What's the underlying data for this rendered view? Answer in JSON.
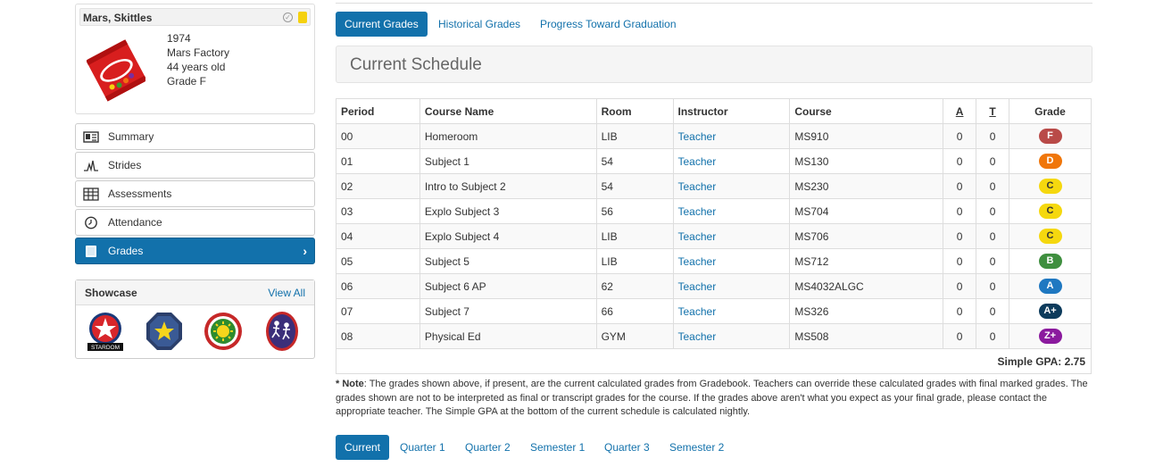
{
  "profile": {
    "name": "Mars, Skittles",
    "lines": [
      "1974",
      "Mars Factory",
      "44 years old",
      "Grade F"
    ],
    "check_icon": "check-circle-icon",
    "note_icon": "sticky-note-icon"
  },
  "nav": {
    "items": [
      {
        "label": "Summary",
        "icon": "id-card-icon"
      },
      {
        "label": "Strides",
        "icon": "pulse-icon"
      },
      {
        "label": "Assessments",
        "icon": "spreadsheet-icon"
      },
      {
        "label": "Attendance",
        "icon": "clock-icon"
      },
      {
        "label": "Grades",
        "icon": "book-icon"
      }
    ],
    "active": "Grades"
  },
  "showcase": {
    "title": "Showcase",
    "view_all": "View All",
    "badge_text": "STARDOM"
  },
  "tabs": [
    "Current Grades",
    "Historical Grades",
    "Progress Toward Graduation"
  ],
  "schedule": {
    "title": "Current Schedule",
    "headers": [
      "Period",
      "Course Name",
      "Room",
      "Instructor",
      "Course",
      "A",
      "T",
      "Grade"
    ],
    "rows": [
      {
        "period": "00",
        "course_name": "Homeroom",
        "room": "LIB",
        "instructor": "Teacher",
        "course": "MS910",
        "a": "0",
        "t": "0",
        "grade": "F",
        "color": "#b94a48"
      },
      {
        "period": "01",
        "course_name": "Subject 1",
        "room": "54",
        "instructor": "Teacher",
        "course": "MS130",
        "a": "0",
        "t": "0",
        "grade": "D",
        "color": "#f0760a"
      },
      {
        "period": "02",
        "course_name": "Intro to Subject 2",
        "room": "54",
        "instructor": "Teacher",
        "course": "MS230",
        "a": "0",
        "t": "0",
        "grade": "C",
        "color": "#f5d80e"
      },
      {
        "period": "03",
        "course_name": "Explo Subject 3",
        "room": "56",
        "instructor": "Teacher",
        "course": "MS704",
        "a": "0",
        "t": "0",
        "grade": "C",
        "color": "#f5d80e"
      },
      {
        "period": "04",
        "course_name": "Explo Subject 4",
        "room": "LIB",
        "instructor": "Teacher",
        "course": "MS706",
        "a": "0",
        "t": "0",
        "grade": "C",
        "color": "#f5d80e"
      },
      {
        "period": "05",
        "course_name": "Subject 5",
        "room": "LIB",
        "instructor": "Teacher",
        "course": "MS712",
        "a": "0",
        "t": "0",
        "grade": "B",
        "color": "#3f8f3f"
      },
      {
        "period": "06",
        "course_name": "Subject 6 AP",
        "room": "62",
        "instructor": "Teacher",
        "course": "MS4032ALGC",
        "a": "0",
        "t": "0",
        "grade": "A",
        "color": "#1f78c1"
      },
      {
        "period": "07",
        "course_name": "Subject 7",
        "room": "66",
        "instructor": "Teacher",
        "course": "MS326",
        "a": "0",
        "t": "0",
        "grade": "A+",
        "color": "#0d3b5c"
      },
      {
        "period": "08",
        "course_name": "Physical Ed",
        "room": "GYM",
        "instructor": "Teacher",
        "course": "MS508",
        "a": "0",
        "t": "0",
        "grade": "Z+",
        "color": "#8b1a9e"
      }
    ],
    "gpa": "Simple GPA: 2.75"
  },
  "note": {
    "label": "* Note",
    "text": ": The grades shown above, if present, are the current calculated grades from Gradebook. Teachers can override these calculated grades with final marked grades. The grades shown are not to be interpreted as final or transcript grades for the course. If the grades above aren't what you expect as your final grade, please contact the appropriate teacher. The Simple GPA at the bottom of the current schedule is calculated nightly."
  },
  "terms": [
    "Current",
    "Quarter 1",
    "Quarter 2",
    "Semester 1",
    "Quarter 3",
    "Semester 2"
  ]
}
